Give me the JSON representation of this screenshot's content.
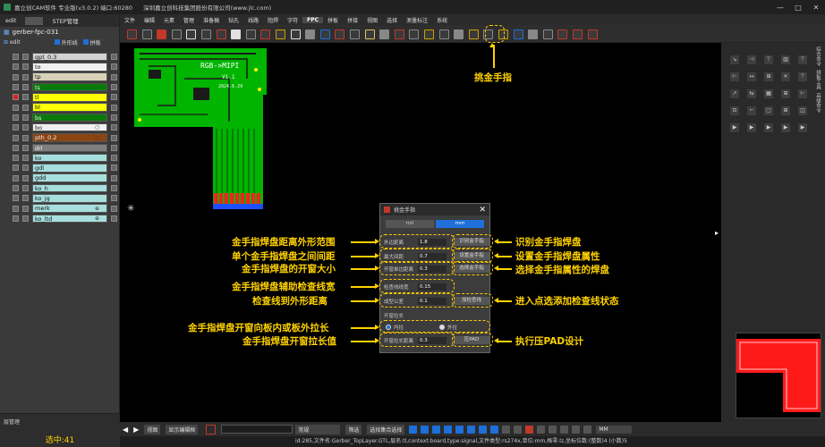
{
  "app": {
    "title": "嘉立创CAM软件 专业版(v3.0.2) 端口:60280",
    "company": "深圳嘉立创科技集团股份有限公司(www.jlc.com)"
  },
  "left_panel": {
    "tabs": [
      "edit",
      "STEP管理"
    ],
    "project": "gerber-fpc-031",
    "head_label": "edit",
    "outline_label": "外形线",
    "split_label": "拼板",
    "layers": [
      {
        "name": "gpt_0.3",
        "color": "#d3d3d3",
        "sym": ""
      },
      {
        "name": "to",
        "color": "#f0f0f0",
        "sym": ""
      },
      {
        "name": "tp",
        "color": "#d9d2b8",
        "sym": ""
      },
      {
        "name": "ts",
        "color": "#0a7a0a",
        "sym": ""
      },
      {
        "name": "tl",
        "color": "#ffff00",
        "sym": ""
      },
      {
        "name": "bl",
        "color": "#ffff00",
        "sym": ""
      },
      {
        "name": "bs",
        "color": "#0a7a0a",
        "sym": ""
      },
      {
        "name": "bo",
        "color": "#f0f0f0",
        "sym": "○"
      },
      {
        "name": "pth_0.2",
        "color": "#8b4513",
        "sym": "○"
      },
      {
        "name": "drl",
        "color": "#7f7f7f",
        "sym": ""
      },
      {
        "name": "ko",
        "color": "#a7dede",
        "sym": ""
      },
      {
        "name": "gdl",
        "color": "#a7dede",
        "sym": ""
      },
      {
        "name": "gdd",
        "color": "#a7dede",
        "sym": ""
      },
      {
        "name": "ko_h",
        "color": "#a7dede",
        "sym": ""
      },
      {
        "name": "ko_jg",
        "color": "#a7dede",
        "sym": ""
      },
      {
        "name": "merk",
        "color": "#a7dede",
        "sym": "⊕"
      },
      {
        "name": "ko_ltd",
        "color": "#a7dede",
        "sym": "⊕"
      }
    ],
    "bottom_label": "层管理",
    "selected_count": "选中:41"
  },
  "menu": [
    "文件",
    "编辑",
    "元素",
    "管理",
    "准备稿",
    "钻孔",
    "线路",
    "阻焊",
    "字符",
    "FPC",
    "拼板",
    "拼接",
    "视图",
    "选择",
    "测量标注",
    "系统"
  ],
  "menu_active": "FPC",
  "pcb": {
    "label1": "RGB->MIPI",
    "label2": "V1.1",
    "label3": "2024.6.29"
  },
  "dialog": {
    "title": "挑金手指",
    "unit_mil": "mil",
    "unit_mm": "mm",
    "fields": [
      {
        "label": "外边距离",
        "value": "1.8"
      },
      {
        "label": "最大间距",
        "value": "0.7"
      },
      {
        "label": "开窗单边距离",
        "value": "0.3"
      },
      {
        "label": "检查线线宽",
        "value": "0.15"
      },
      {
        "label": "成型公差",
        "value": "0.1"
      }
    ],
    "buttons": [
      "识别金手指",
      "设置金手指",
      "选择金手指",
      "加检查线",
      "压PAD"
    ],
    "group_label": "开窗拉长",
    "radio_in": "内拉",
    "radio_out": "外拉",
    "pull_label": "开窗拉长距离",
    "pull_value": "0.3"
  },
  "annotations": {
    "top": "挑金手指",
    "left": [
      "金手指焊盘距离外形范围",
      "单个金手指焊盘之间间距",
      "金手指焊盘的开窗大小",
      "金手指焊盘辅助检查线宽",
      "检查线到外形距离",
      "金手指焊盘开窗向板内或板外拉长",
      "金手指焊盘开窗拉长值"
    ],
    "right": [
      "识别金手指焊盘",
      "设置金手指焊盘属性",
      "选择金手指属性的焊盘",
      "进入点选添加检查线状态",
      "执行压PAD设计"
    ]
  },
  "right_panel": {
    "vtabs": [
      "综合命令",
      "拼板工具",
      "高级命令"
    ]
  },
  "bottom": {
    "zoom_label": "视图",
    "show_label": "显示编辑框",
    "mode_label": "常规",
    "unit": "MM",
    "filter_label": "筛选",
    "select_label": "选择集合选择",
    "status": "id:285,文件名:Gerber_TopLayer.GTL,层名:tl,context:board,type:signal,文件类型:rs274x,单位:mm,格零:lz,坐标位数:(整数)4 (小数)5"
  },
  "colors": {
    "annotation": "#ffd200",
    "pcb_green": "#00c000",
    "pcb_mask": "#1a1a1a",
    "accent": "#1e6fd9"
  }
}
